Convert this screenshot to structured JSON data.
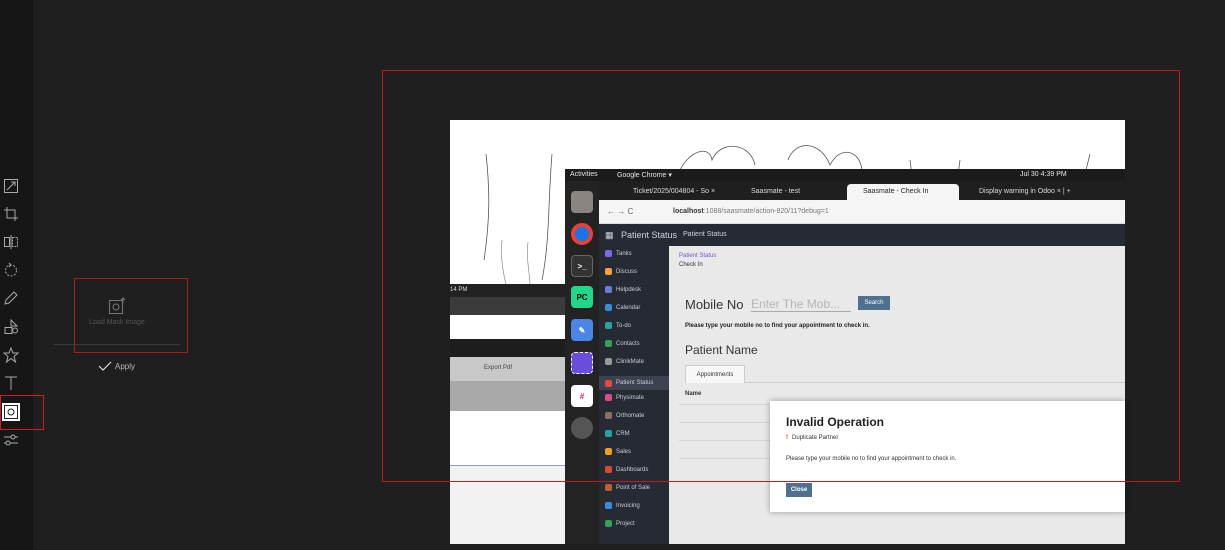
{
  "editor": {
    "tools": [
      "resize-icon",
      "crop-icon",
      "flip-icon",
      "rotate-icon",
      "draw-icon",
      "shapes-icon",
      "sticker-icon",
      "text-icon",
      "mask-icon",
      "adjust-icon"
    ],
    "mask_panel": {
      "label": "Load Mask Image"
    },
    "apply_label": "Apply",
    "accent": "#c41a1a"
  },
  "screenshot": {
    "prev_window": {
      "clock": "14 PM",
      "export_label": "Export Pdf"
    },
    "gnome": {
      "activities": "Activities",
      "app_name": "Google Chrome ▾",
      "datetime": "Jul 30  4:39 PM"
    },
    "browser": {
      "tabs": [
        {
          "label": "Ticket/2025/004804 - So"
        },
        {
          "label": "Saasmate - test"
        },
        {
          "label": "Saasmate - Check In"
        },
        {
          "label": "Display warning in Odoo"
        }
      ],
      "url_host": "localhost",
      "url_path": ":1088/saasmate/action-820/11?debug=1"
    },
    "odoo": {
      "app_title": "Patient Status",
      "menu_title": "Patient Status",
      "sidebar": [
        {
          "label": "Tanks",
          "color": "#7b68ee"
        },
        {
          "label": "Discuss",
          "color": "#f4a23b"
        },
        {
          "label": "Helpdesk",
          "color": "#6d7cd6"
        },
        {
          "label": "Calendar",
          "color": "#3c8dd9"
        },
        {
          "label": "To-do",
          "color": "#2aa3a3"
        },
        {
          "label": "Contacts",
          "color": "#34a058"
        },
        {
          "label": "ClinikMate",
          "color": "#999999"
        },
        {
          "label": "Patient Status",
          "color": "#e64a3b"
        },
        {
          "label": "Physimate",
          "color": "#e04a8a"
        },
        {
          "label": "Orthomate",
          "color": "#8d6e63"
        },
        {
          "label": "CRM",
          "color": "#21a6a6"
        },
        {
          "label": "Sales",
          "color": "#f59c1a"
        },
        {
          "label": "Dashboards",
          "color": "#d8493d"
        },
        {
          "label": "Point of Sale",
          "color": "#c06030"
        },
        {
          "label": "Invoicing",
          "color": "#3c8dd9"
        },
        {
          "label": "Project",
          "color": "#34a058"
        }
      ],
      "breadcrumb": "Patient Status",
      "subcrumb": "Check In",
      "mobile_label": "Mobile No",
      "mobile_placeholder": "Enter The Mob...",
      "search_label": "Search",
      "hint": "Please type your mobile no to find your appointment to check in.",
      "patient_name_label": "Patient Name",
      "tab_label": "Appointments",
      "column_name": "Name"
    },
    "dialog": {
      "title": "Invalid Operation",
      "subtitle": "Duplicate Partner",
      "message": "Please type your mobile no to find your appointment to check in.",
      "close_label": "Close"
    }
  }
}
